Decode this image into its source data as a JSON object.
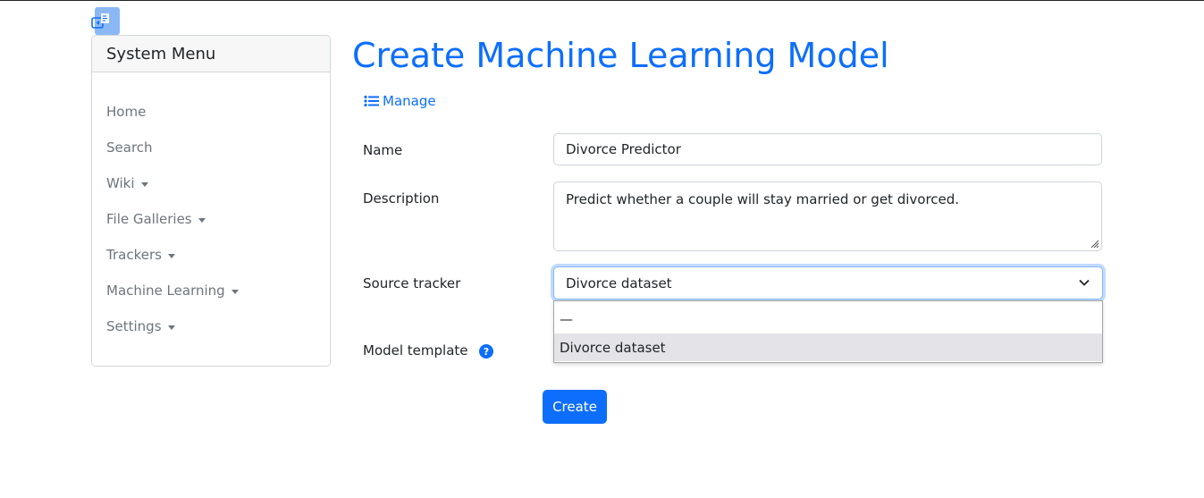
{
  "sidebar": {
    "title": "System Menu",
    "items": [
      {
        "label": "Home",
        "has_caret": false
      },
      {
        "label": "Search",
        "has_caret": false
      },
      {
        "label": "Wiki",
        "has_caret": true
      },
      {
        "label": "File Galleries",
        "has_caret": true
      },
      {
        "label": "Trackers",
        "has_caret": true
      },
      {
        "label": "Machine Learning",
        "has_caret": true
      },
      {
        "label": "Settings",
        "has_caret": true
      }
    ]
  },
  "main": {
    "title": "Create Machine Learning Model",
    "manage_label": "Manage",
    "form": {
      "name_label": "Name",
      "name_value": "Divorce Predictor",
      "description_label": "Description",
      "description_value": "Predict whether a couple will stay married or get divorced.",
      "source_tracker_label": "Source tracker",
      "source_tracker_value": "Divorce dataset",
      "source_tracker_options": [
        "—",
        "Divorce dataset"
      ],
      "model_template_label": "Model template",
      "create_label": "Create"
    }
  },
  "colors": {
    "accent": "#0d6efd",
    "muted_text": "#6c757d",
    "dropdown_highlight": "#e3e3e8"
  },
  "icons": {
    "sidebar_toggle": "sidebar-toggle-icon",
    "manage": "list-icon",
    "help": "question-circle-icon",
    "select": "chevron-down-icon",
    "caret": "caret-down-icon"
  }
}
